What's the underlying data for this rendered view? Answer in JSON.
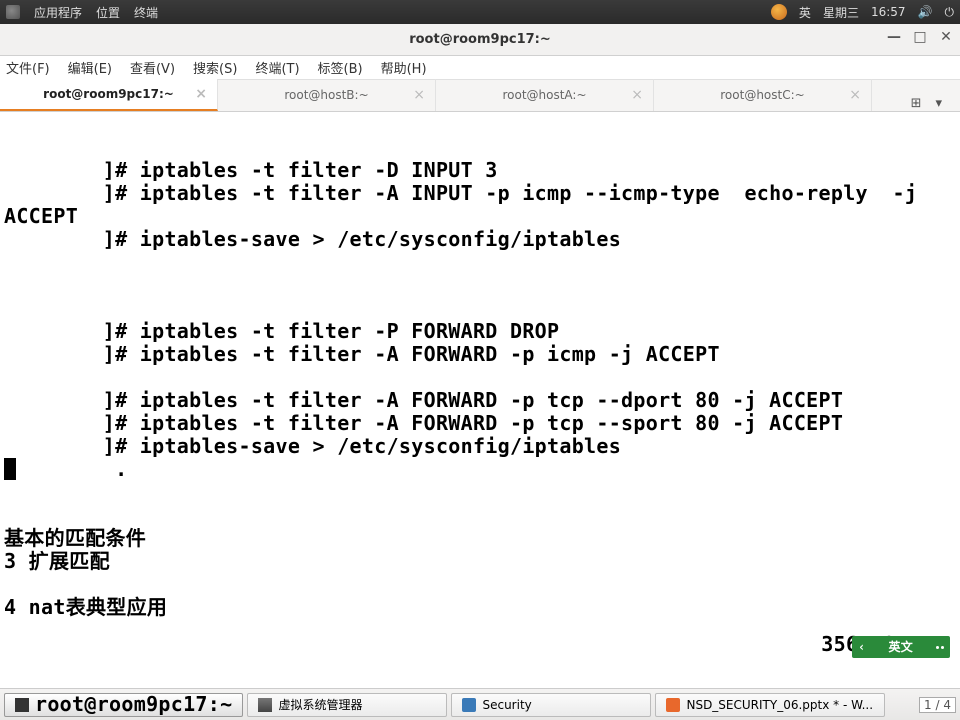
{
  "panel": {
    "apps": "应用程序",
    "places": "位置",
    "terminal": "终端",
    "input_lang": "英",
    "date": "星期三",
    "time": "16:57"
  },
  "window": {
    "title": "root@room9pc17:~"
  },
  "menu": {
    "file": "文件(F)",
    "edit": "编辑(E)",
    "view": "查看(V)",
    "search": "搜索(S)",
    "terminal": "终端(T)",
    "tabs": "标签(B)",
    "help": "帮助(H)"
  },
  "tabs": [
    {
      "label": "root@room9pc17:~",
      "active": true
    },
    {
      "label": "root@hostB:~",
      "active": false
    },
    {
      "label": "root@hostA:~",
      "active": false
    },
    {
      "label": "root@hostC:~",
      "active": false
    }
  ],
  "terminal_lines": [
    "        ]# iptables -t filter -D INPUT 3",
    "        ]# iptables -t filter -A INPUT -p icmp --icmp-type  echo-reply  -j ACCEPT",
    "        ]# iptables-save > /etc/sysconfig/iptables",
    "",
    "",
    "",
    "        ]# iptables -t filter -P FORWARD DROP",
    "        ]# iptables -t filter -A FORWARD -p icmp -j ACCEPT",
    "",
    "        ]# iptables -t filter -A FORWARD -p tcp --dport 80 -j ACCEPT",
    "        ]# iptables -t filter -A FORWARD -p tcp --sport 80 -j ACCEPT",
    "        ]# iptables-save > /etc/sysconfig/iptables",
    "         .",
    "",
    "",
    "基本的匹配条件",
    "3 扩展匹配",
    "",
    "4 nat表典型应用"
  ],
  "vim_status": "3565,0-1",
  "ime": {
    "label": "英文"
  },
  "taskbar": {
    "items": [
      {
        "label": "root@room9pc17:~",
        "class": "term active"
      },
      {
        "label": "虚拟系统管理器",
        "class": "vmm"
      },
      {
        "label": "Security",
        "class": "sec"
      },
      {
        "label": "NSD_SECURITY_06.pptx * - W...",
        "class": "wps"
      }
    ],
    "pages": "1 / 4"
  }
}
